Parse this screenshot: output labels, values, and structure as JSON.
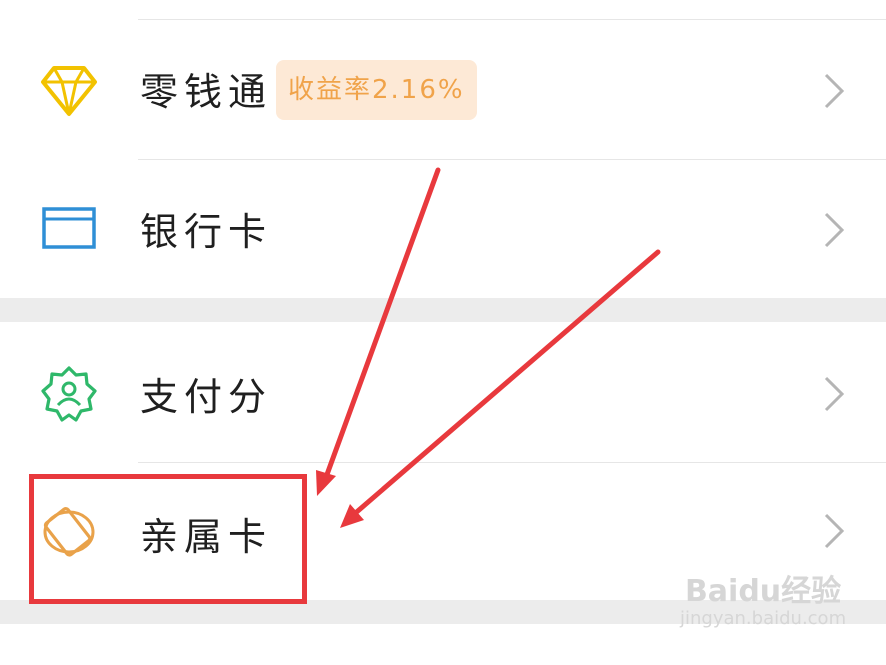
{
  "menu": {
    "items": [
      {
        "label": "零钱通",
        "badge": "收益率2.16%",
        "icon": "diamond-icon"
      },
      {
        "label": "银行卡",
        "icon": "bank-card-icon"
      },
      {
        "label": "支付分",
        "icon": "badge-user-icon"
      },
      {
        "label": "亲属卡",
        "icon": "family-card-icon"
      }
    ]
  },
  "colors": {
    "diamond": "#f2c200",
    "bank_card": "#2f8fd6",
    "pay_score": "#2fb86a",
    "family_card": "#e9a24a",
    "badge_bg": "#fde9d6",
    "badge_text": "#f0a34a",
    "annotation": "#e8393d"
  },
  "watermark": {
    "main": "Baidu经验",
    "sub": "jingyan.baidu.com"
  }
}
